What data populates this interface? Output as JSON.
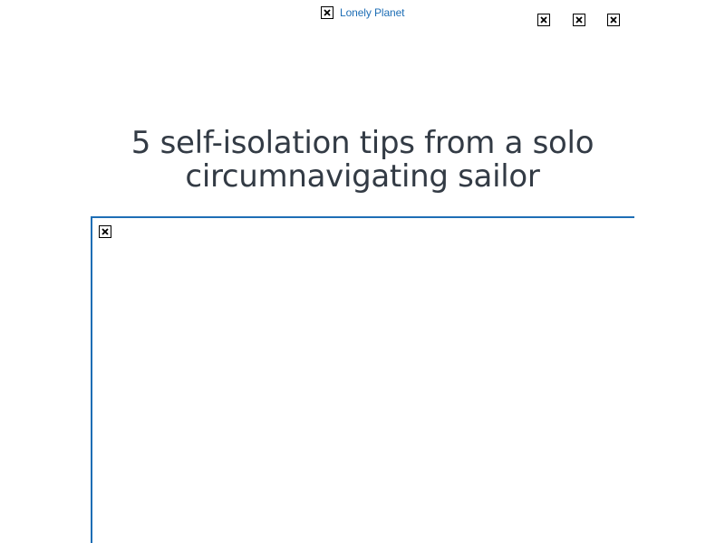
{
  "header": {
    "logo_label": "Lonely Planet",
    "logo_icon": "broken-image-icon",
    "action_icons": [
      "broken-image-icon",
      "broken-image-icon",
      "broken-image-icon"
    ]
  },
  "article": {
    "title": "5 self-isolation tips from a solo circumnavigating sailor"
  },
  "media": {
    "icon": "broken-image-icon"
  },
  "colors": {
    "link": "#1e6eb5",
    "title": "#333b45",
    "frame_border": "#1e6eb5",
    "background": "#ffffff"
  }
}
